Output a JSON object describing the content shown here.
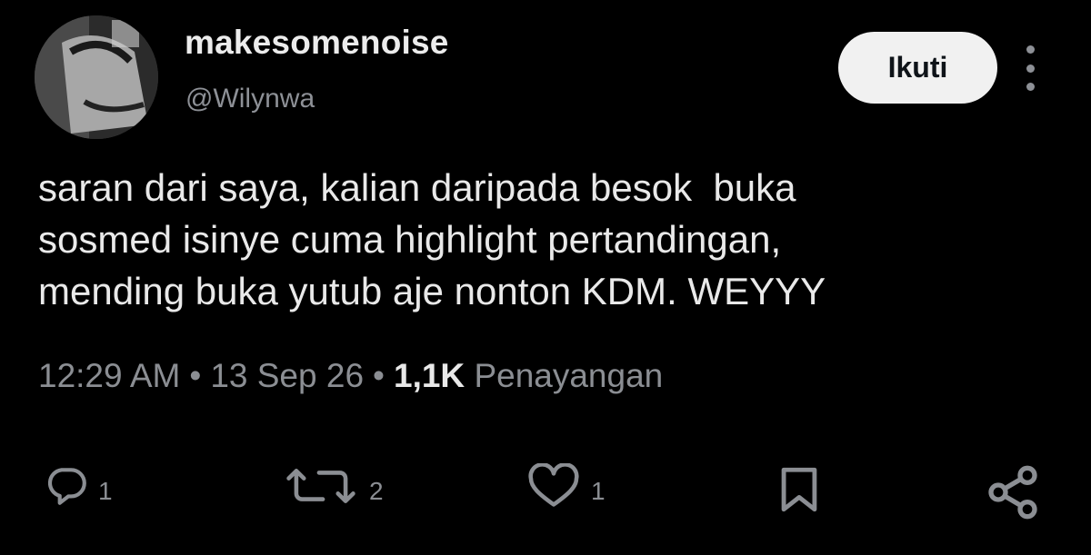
{
  "author": {
    "display_name": "makesomenoise",
    "handle": "@Wilynwa"
  },
  "follow_label": "Ikuti",
  "tweet": {
    "lines": [
      "saran dari saya, kalian daripada besok  buka",
      "sosmed isinye cuma highlight pertandingan,",
      "mending buka yutub aje nonton KDM. WEYYY"
    ]
  },
  "meta": {
    "time": "12:29 AM",
    "separator": "•",
    "date": "13 Sep 26",
    "views_count": "1,1K",
    "views_label": "Penayangan"
  },
  "actions": {
    "reply_count": "1",
    "retweet_count": "2",
    "like_count": "1"
  },
  "icons": [
    "reply-icon",
    "retweet-icon",
    "like-icon",
    "bookmark-icon",
    "share-icon",
    "more-icon"
  ],
  "colors": {
    "background": "#000000",
    "text": "#e7e9ea",
    "secondary": "#8b8e93",
    "button_bg": "#f1f1f1"
  }
}
